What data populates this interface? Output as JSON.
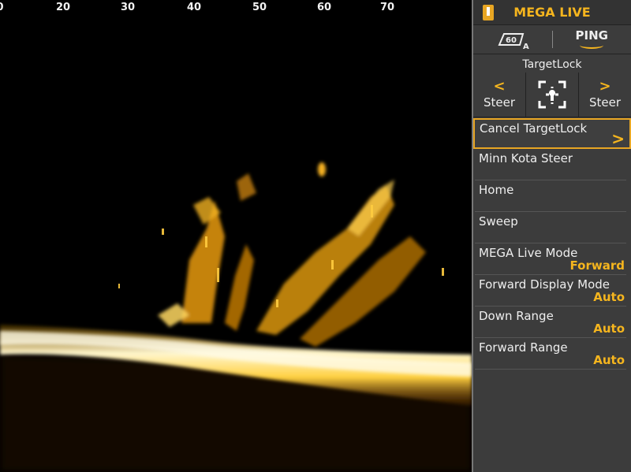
{
  "depth_scale": {
    "ticks": [
      {
        "label": "0"
      },
      {
        "label": "20"
      },
      {
        "label": "30"
      },
      {
        "label": "40"
      },
      {
        "label": "50"
      },
      {
        "label": "60"
      },
      {
        "label": "70"
      }
    ]
  },
  "panel": {
    "title": "MEGA LIVE",
    "range_icon_value": "60",
    "range_icon_mode": "A",
    "ping_label": "PING",
    "targetlock_label": "TargetLock",
    "steer_left_label": "Steer",
    "steer_right_label": "Steer",
    "menu": [
      {
        "label": "Cancel TargetLock",
        "value": ""
      },
      {
        "label": "Minn Kota Steer",
        "value": ""
      },
      {
        "label": "Home",
        "value": ""
      },
      {
        "label": "Sweep",
        "value": ""
      },
      {
        "label": "MEGA Live Mode",
        "value": "Forward"
      },
      {
        "label": "Forward Display Mode",
        "value": "Auto"
      },
      {
        "label": "Down Range",
        "value": "Auto"
      },
      {
        "label": "Forward Range",
        "value": "Auto"
      }
    ]
  },
  "colors": {
    "accent": "#f5b51e",
    "sonar_bright": "#fff3c0",
    "sonar_mid": "#f0a800",
    "sonar_dark": "#8a4a00"
  }
}
